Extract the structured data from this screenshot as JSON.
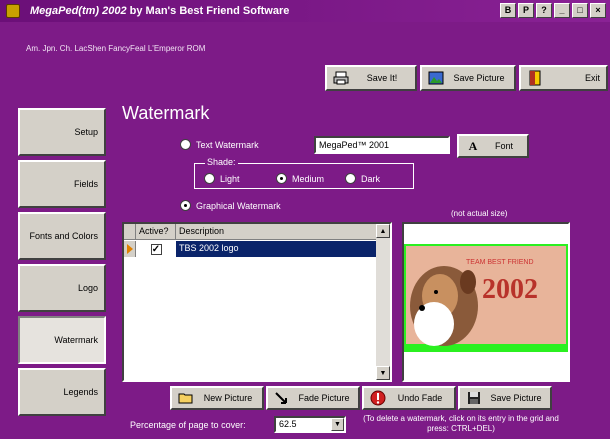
{
  "window": {
    "title_italic": "MegaPed(tm) 2002",
    "title_rest": " by Man's Best Friend Software",
    "subtitle": "Am. Jpn. Ch. LacShen FancyFeal L'Emperor ROM"
  },
  "titlebar_buttons": [
    "B",
    "P",
    "?",
    "_",
    "□",
    "×"
  ],
  "toolbar": {
    "save_it": "Save It!",
    "save_picture": "Save Picture",
    "exit": "Exit"
  },
  "nav": {
    "items": [
      {
        "label": "Setup"
      },
      {
        "label": "Fields"
      },
      {
        "label": "Fonts and Colors"
      },
      {
        "label": "Logo"
      },
      {
        "label": "Watermark"
      },
      {
        "label": "Legends"
      }
    ]
  },
  "section_title": "Watermark",
  "watermark": {
    "text_option": "Text Watermark",
    "text_value": "MegaPed™ 2001",
    "font_button": "Font",
    "shade_legend": "Shade:",
    "shade_light": "Light",
    "shade_medium": "Medium",
    "shade_dark": "Dark",
    "graphical_option": "Graphical Watermark",
    "preview_note": "(not actual size)"
  },
  "grid": {
    "col_active": "Active?",
    "col_description": "Description",
    "row_description": "TBS 2002 logo"
  },
  "buttons": {
    "new_picture": "New Picture",
    "fade_picture": "Fade Picture",
    "undo_fade": "Undo Fade",
    "save_picture": "Save Picture"
  },
  "percentage": {
    "label": "Percentage of page to cover:",
    "value": "62.5"
  },
  "hint": "(To delete a watermark, click on its entry in the grid and press: CTRL+DEL)",
  "preview_image": {
    "big_text": "2002",
    "small_text": "TEAM BEST FRIEND"
  },
  "colors": {
    "background": "#7d1b87",
    "selection": "#0a246a",
    "preview_bar": "#2bf020"
  }
}
